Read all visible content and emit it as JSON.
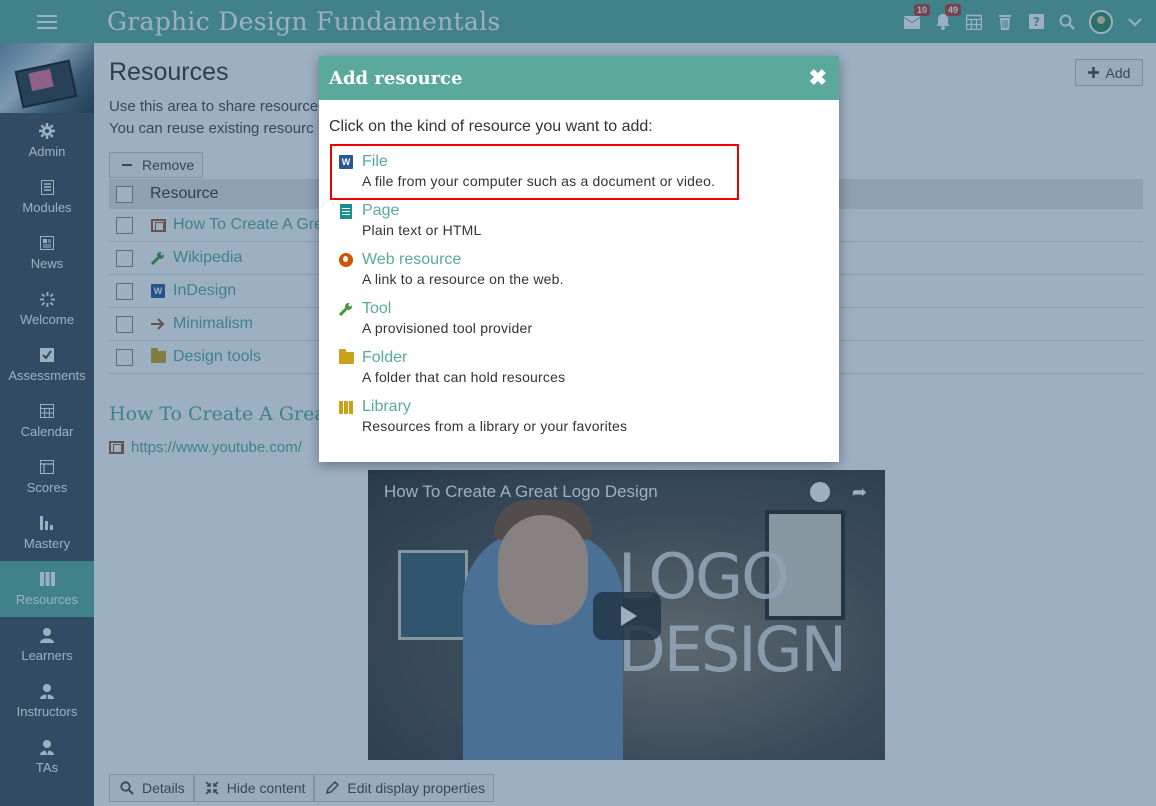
{
  "app": {
    "title": "Graphic Design Fundamentals"
  },
  "topbar": {
    "messages_badge": "10",
    "notifications_badge": "49"
  },
  "sidebar": {
    "items": [
      {
        "label": "Admin",
        "icon": "gear-icon"
      },
      {
        "label": "Modules",
        "icon": "modules-icon"
      },
      {
        "label": "News",
        "icon": "news-icon"
      },
      {
        "label": "Welcome",
        "icon": "welcome-icon"
      },
      {
        "label": "Assessments",
        "icon": "check-icon"
      },
      {
        "label": "Calendar",
        "icon": "calendar-icon"
      },
      {
        "label": "Scores",
        "icon": "scores-icon"
      },
      {
        "label": "Mastery",
        "icon": "bar-chart-icon"
      },
      {
        "label": "Resources",
        "icon": "library-icon",
        "active": true
      },
      {
        "label": "Learners",
        "icon": "person-icon"
      },
      {
        "label": "Instructors",
        "icon": "instructor-icon"
      },
      {
        "label": "TAs",
        "icon": "ta-icon"
      }
    ]
  },
  "main": {
    "page_title": "Resources",
    "add_label": "Add",
    "intro_line1": "Use this area to share resource",
    "intro_line2": "You can reuse existing resourc",
    "remove_label": "Remove",
    "column_header": "Resource",
    "rows": [
      {
        "label": "How To Create A Gre",
        "icon": "video-icon"
      },
      {
        "label": "Wikipedia",
        "icon": "tool-icon"
      },
      {
        "label": "InDesign",
        "icon": "word-icon"
      },
      {
        "label": "Minimalism",
        "icon": "arrow-icon"
      },
      {
        "label": "Design tools",
        "icon": "folder-icon"
      }
    ],
    "section_title": "How To Create A Grea",
    "section_url": "https://www.youtube.com/",
    "video": {
      "title": "How To Create A Great Logo Design",
      "watermark": "LOGO DESIGN"
    },
    "toolbar": {
      "details_label": "Details",
      "hide_content_label": "Hide content",
      "edit_display_label": "Edit display properties"
    }
  },
  "modal": {
    "title": "Add resource",
    "close_symbol": "✖",
    "prompt": "Click on the kind of resource you want to add:",
    "options": [
      {
        "title": "File",
        "desc": "A file from your computer such as a document or video.",
        "icon": "word-file-icon",
        "highlighted": true
      },
      {
        "title": "Page",
        "desc": "Plain text or HTML",
        "icon": "page-icon"
      },
      {
        "title": "Web resource",
        "desc": "A link to a resource on the web.",
        "icon": "globe-icon"
      },
      {
        "title": "Tool",
        "desc": "A provisioned tool provider",
        "icon": "wrench-icon"
      },
      {
        "title": "Folder",
        "desc": "A folder that can hold resources",
        "icon": "folder-icon"
      },
      {
        "title": "Library",
        "desc": "Resources from a library or your favorites",
        "icon": "library-icon"
      }
    ]
  },
  "colors": {
    "accent": "#5aa99a",
    "sidebar_bg": "#3b4752",
    "overlay": "#23507873",
    "highlight_border": "#e00000"
  }
}
